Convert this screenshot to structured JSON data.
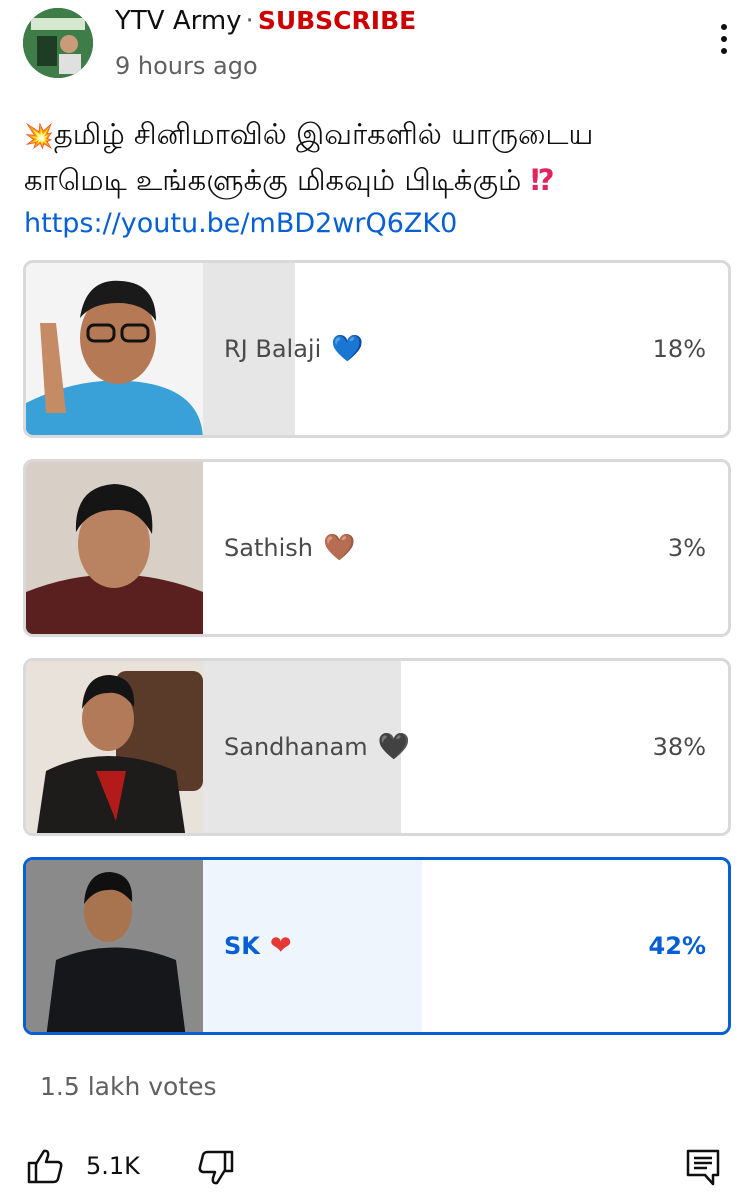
{
  "header": {
    "channel_name": "YTV Army",
    "separator": "·",
    "subscribe_label": "SUBSCRIBE",
    "timestamp": "9 hours ago",
    "menu_icon": "more-vert-icon"
  },
  "post": {
    "text_line1": "தமிழ் சினிமாவில் இவர்களில் யாருடைய",
    "text_line2": "காமெடி உங்களுக்கு மிகவும் பிடிக்கும்",
    "emoji_start": "💥",
    "emoji_end": "⁉",
    "link": "https://youtu.be/mBD2wrQ6ZK0"
  },
  "poll": {
    "options": [
      {
        "label": "RJ Balaji",
        "heart": "💙",
        "heart_color": "#1e88e5",
        "percent_text": "18%",
        "percent": 18,
        "selected": false
      },
      {
        "label": "Sathish",
        "heart": "🤎",
        "heart_color": "#8d6239",
        "percent_text": "3%",
        "percent": 3,
        "selected": false
      },
      {
        "label": "Sandhanam",
        "heart": "🖤",
        "heart_color": "#111111",
        "percent_text": "38%",
        "percent": 38,
        "selected": false
      },
      {
        "label": "SK",
        "heart": "❤",
        "heart_color": "#e53935",
        "percent_text": "42%",
        "percent": 42,
        "selected": true
      }
    ],
    "votes": "1.5 lakh votes"
  },
  "actions": {
    "like_count": "5.1K",
    "like_icon": "thumbs-up-icon",
    "dislike_icon": "thumbs-down-icon",
    "comment_icon": "comment-icon"
  },
  "colors": {
    "accent": "#065fd4",
    "subscribe": "#cc0000",
    "fill": "#e6e6e6"
  }
}
